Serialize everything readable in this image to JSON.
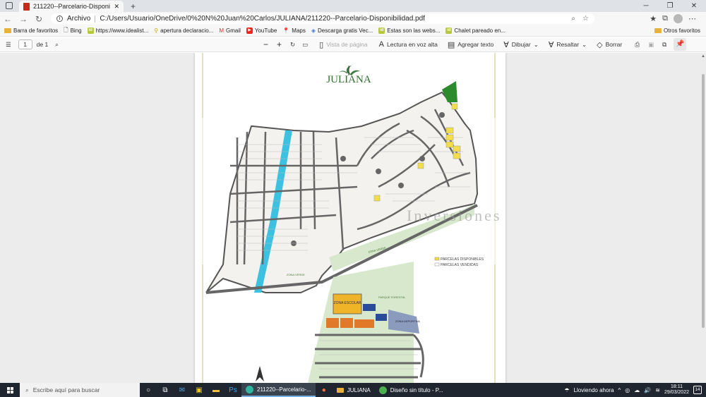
{
  "browser": {
    "tab_title": "211220--Parcelario-Disponibilida",
    "new_tab_symbol": "+",
    "window_controls": [
      "─",
      "❐",
      "✕"
    ],
    "address_label": "Archivo",
    "url": "C:/Users/Usuario/OneDrive/0%20N%20Juan%20Carlos/JULIANA/211220--Parcelario-Disponibilidad.pdf"
  },
  "favorites": {
    "items": [
      {
        "label": "Barra de favoritos",
        "icon": "folder-icon"
      },
      {
        "label": "Bing",
        "icon": "page-icon"
      },
      {
        "label": "https://www.idealist...",
        "icon": "idealista-icon"
      },
      {
        "label": "apertura declaracio...",
        "icon": "tax-icon"
      },
      {
        "label": "Gmail",
        "icon": "gmail-icon"
      },
      {
        "label": "YouTube",
        "icon": "youtube-icon"
      },
      {
        "label": "Maps",
        "icon": "maps-icon"
      },
      {
        "label": "Descarga gratis Vec...",
        "icon": "vecteezy-icon"
      },
      {
        "label": "Estas son las webs...",
        "icon": "idealista-icon"
      },
      {
        "label": "Chalet pareado en...",
        "icon": "idealista-icon"
      }
    ],
    "other": "Otros favoritos"
  },
  "pdf_toolbar": {
    "page_current": "1",
    "page_total": "de 1",
    "page_view": "Vista de página",
    "read_aloud": "Lectura en voz alta",
    "add_text": "Agregar texto",
    "draw": "Dibujar",
    "highlight": "Resaltar",
    "erase": "Borrar"
  },
  "document": {
    "logo": "JULIANA",
    "legend_available": "PARCELAS DISPONIBLES",
    "legend_sold": "PARCELAS VENDIDAS",
    "zone_school": "ZONA ESCOLAR",
    "zone_green_1": "ZONA VERDE",
    "zone_green_2": "ZONA VERDE",
    "zone_forest": "PARQUE FORESTAL",
    "zone_sports": "ZONA DEPORTIVA",
    "watermark_text": "Inversiones"
  },
  "taskbar": {
    "search_placeholder": "Escribe aquí para buscar",
    "apps": [
      {
        "label": "211220--Parcelario-...",
        "active": true
      },
      {
        "label": "JULIANA",
        "active": false
      },
      {
        "label": "Diseño sin título - P...",
        "active": false
      }
    ],
    "weather": "Lloviendo ahora",
    "time": "18:11",
    "date": "29/03/2022",
    "notifications": "14"
  },
  "colors": {
    "available": "#f2de4a",
    "sold": "#ffffff",
    "green_zone": "#d8e8cc",
    "river": "#3cc2e0",
    "school": "#f0b429",
    "forest_tree": "#2d8a2d"
  }
}
